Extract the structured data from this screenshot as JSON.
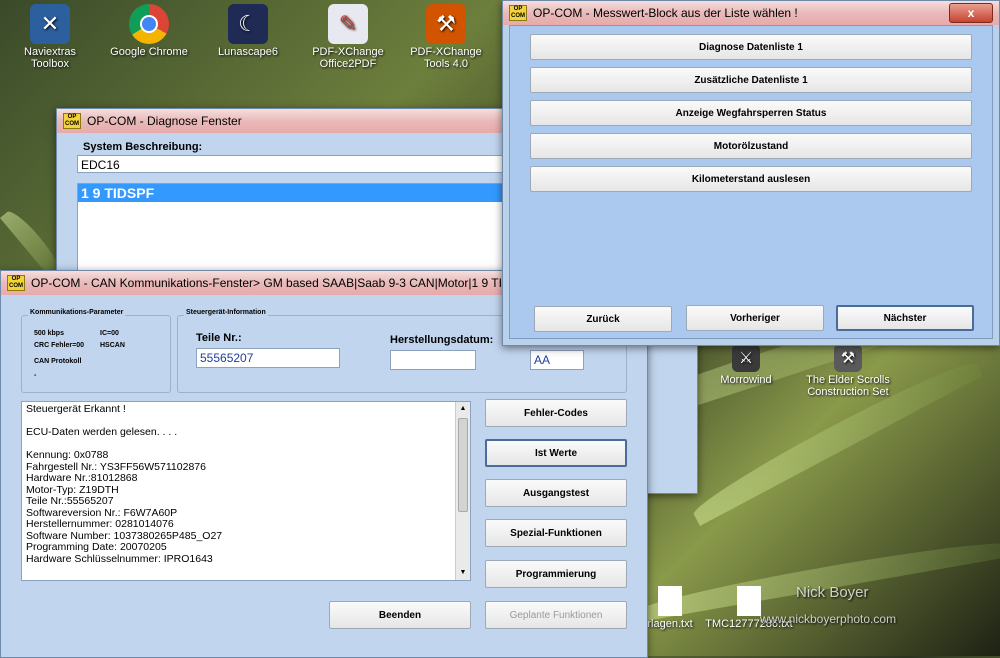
{
  "desktop": {
    "icons": [
      {
        "label": "Naviextras Toolbox",
        "icon": "globe-tool-icon"
      },
      {
        "label": "Google Chrome",
        "icon": "chrome-icon"
      },
      {
        "label": "Lunascape6",
        "icon": "moon-icon"
      },
      {
        "label": "PDF-XChange Office2PDF",
        "icon": "pdf-icon"
      },
      {
        "label": "PDF-XChange Tools 4.0",
        "icon": "pdf-tools-icon"
      },
      {
        "label": "Morrowind",
        "icon": "game-icon"
      },
      {
        "label": "The Elder Scrolls Construction Set",
        "icon": "construction-icon"
      },
      {
        "label": "rlagen.txt",
        "icon": "text-file-icon"
      },
      {
        "label": "TMC12777286.txt",
        "icon": "text-file-icon"
      }
    ],
    "watermark_name": "Nick Boyer",
    "watermark_url": "www.nickboyerphoto.com"
  },
  "diag_window": {
    "title": "OP-COM - Diagnose Fenster",
    "system_label": "System Beschreibung:",
    "system_value": "EDC16",
    "list_selected": "1 9 TIDSPF"
  },
  "can_window": {
    "title": "OP-COM - CAN Kommunikations-Fenster> GM based SAAB|Saab 9-3 CAN|Motor|1 9 TIDSPF",
    "comm_group": {
      "label": "Kommunikations-Parameter",
      "baud": "500 kbps",
      "ic": "IC=00",
      "crc": "CRC Fehler=00",
      "hscan": "HSCAN",
      "protocol_label": "CAN Protokoll",
      "protocol_value": "-"
    },
    "ecu_group": {
      "label": "Steuergerät-Information",
      "part_label": "Teile Nr.:",
      "part_value": "55565207",
      "date_label": "Herstellungsdatum:",
      "date_value": "",
      "extra_value": "AA"
    },
    "log_lines": [
      "Steuergerät Erkannt !",
      "",
      "ECU-Daten werden gelesen. . . .",
      "",
      "Kennung: 0x0788",
      "Fahrgestell Nr.: YS3FF56W571102876",
      "Hardware Nr.:81012868",
      "Motor-Typ: Z19DTH",
      "Teile Nr.:55565207",
      "Softwareversion Nr.: F6W7A60P",
      "Herstellernummer: 0281014076",
      "Software Number: 1037380265P485_O27",
      "Programming Date: 20070205",
      "Hardware Schlüsselnummer: IPRO1643"
    ],
    "buttons": {
      "fehler": "Fehler-Codes",
      "ist": "Ist Werte",
      "ausgang": "Ausgangstest",
      "spezial": "Spezial-Funktionen",
      "programmierung": "Programmierung",
      "beenden": "Beenden",
      "geplante": "Geplante Funktionen"
    }
  },
  "mess_window": {
    "title": "OP-COM - Messwert-Block aus der Liste wählen !",
    "close_label": "x",
    "items": [
      "Diagnose Datenliste 1",
      "Zusätzliche Datenliste 1",
      "Anzeige Wegfahrsperren Status",
      "Motorölzustand",
      "Kilometerstand auslesen"
    ],
    "back": "Zurück",
    "prev": "Vorheriger",
    "next": "Nächster"
  }
}
